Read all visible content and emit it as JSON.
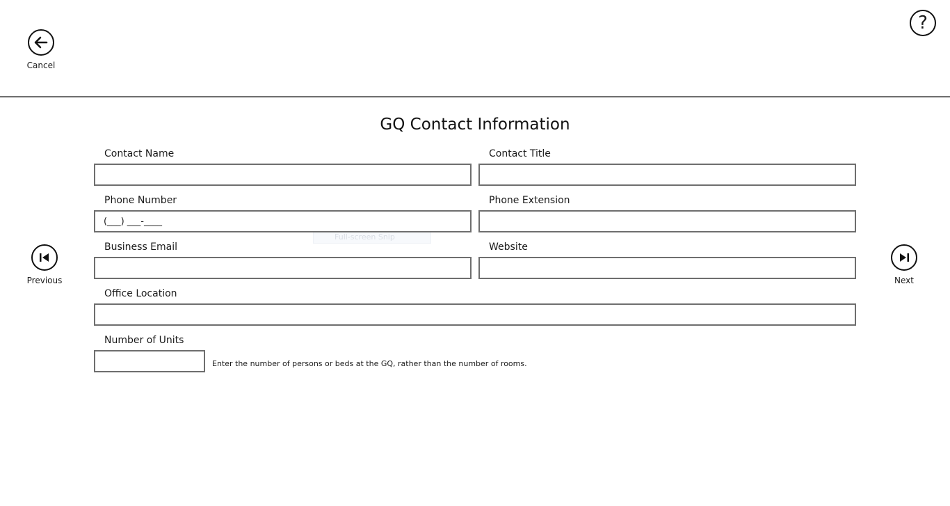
{
  "header": {
    "cancel_label": "Cancel",
    "help_symbol": "?"
  },
  "page": {
    "title": "GQ Contact Information"
  },
  "nav": {
    "previous_label": "Previous",
    "next_label": "Next"
  },
  "form": {
    "contact_name": {
      "label": "Contact Name",
      "value": ""
    },
    "contact_title": {
      "label": "Contact Title",
      "value": ""
    },
    "phone_number": {
      "label": "Phone Number",
      "placeholder": "(___) ___-____"
    },
    "phone_extension": {
      "label": "Phone Extension",
      "value": ""
    },
    "business_email": {
      "label": "Business Email",
      "value": ""
    },
    "website": {
      "label": "Website",
      "value": ""
    },
    "office_location": {
      "label": "Office Location",
      "value": ""
    },
    "number_of_units": {
      "label": "Number of Units",
      "value": "",
      "hint": "Enter the number of persons or beds at the GQ, rather than the number of rooms."
    }
  },
  "overlay": {
    "snip_text": "Full-screen Snip"
  },
  "icons": {
    "cancel": "arrow-left-icon",
    "help": "question-mark-icon",
    "previous": "skip-previous-icon",
    "next": "skip-next-icon"
  }
}
